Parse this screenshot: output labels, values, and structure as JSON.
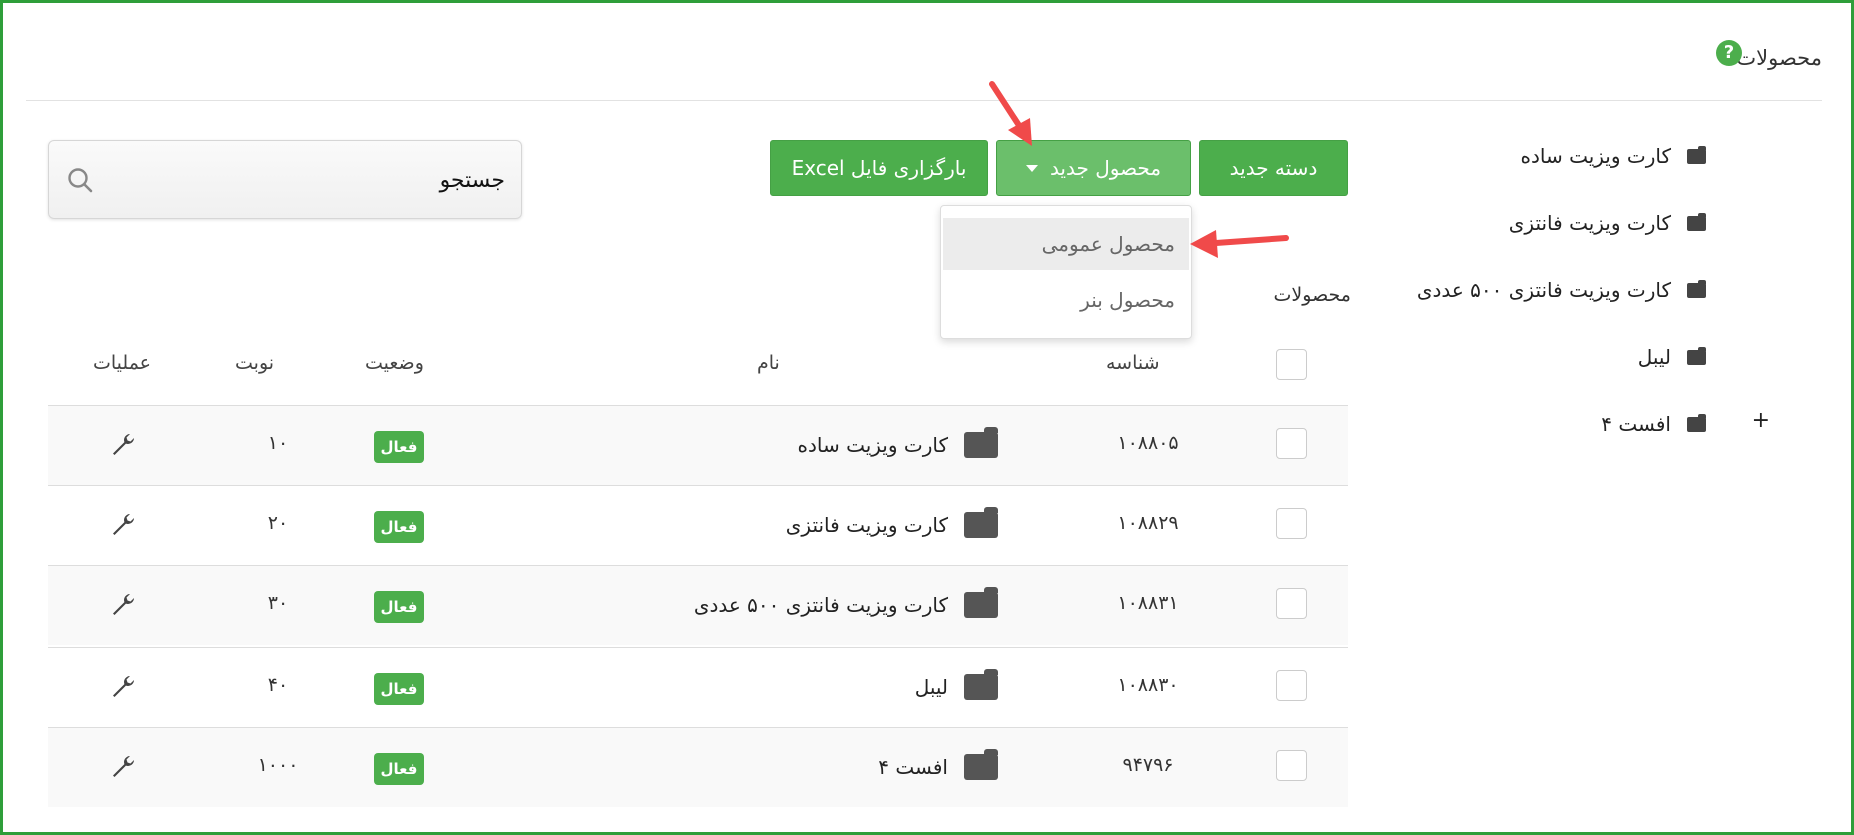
{
  "page": {
    "title": "محصولات",
    "help_icon": "question-circle-icon"
  },
  "sidebar": {
    "items": [
      {
        "label": "کارت ویزیت ساده",
        "icon": "folder-icon"
      },
      {
        "label": "کارت ویزیت فانتزی",
        "icon": "folder-icon"
      },
      {
        "label": "کارت ویزیت فانتزی ۵۰۰ عددی",
        "icon": "folder-icon"
      },
      {
        "label": "لیبل",
        "icon": "folder-icon"
      },
      {
        "label": "افست ۴",
        "icon": "folder-icon"
      }
    ],
    "expand_symbol": "+"
  },
  "toolbar": {
    "new_category": "دسته جدید",
    "new_product": "محصول جدید",
    "upload_excel": "بارگزاری فایل Excel"
  },
  "dropdown": {
    "items": [
      "محصول عمومی",
      "محصول بنر"
    ],
    "highlighted_index": 0
  },
  "search": {
    "placeholder": "جستجو",
    "icon": "search-icon"
  },
  "section_label": "محصولات",
  "table": {
    "headers": {
      "id": "شناسه",
      "name": "نام",
      "status": "وضعیت",
      "order": "نوبت",
      "actions": "عملیات"
    },
    "rows": [
      {
        "id": "۱۰۸۸۰۵",
        "name": "کارت ویزیت ساده",
        "status": "فعال",
        "order": "۱۰"
      },
      {
        "id": "۱۰۸۸۲۹",
        "name": "کارت ویزیت فانتزی",
        "status": "فعال",
        "order": "۲۰"
      },
      {
        "id": "۱۰۸۸۳۱",
        "name": "کارت ویزیت فانتزی ۵۰۰ عددی",
        "status": "فعال",
        "order": "۳۰"
      },
      {
        "id": "۱۰۸۸۳۰",
        "name": "لیبل",
        "status": "فعال",
        "order": "۴۰"
      },
      {
        "id": "۹۴۷۹۶",
        "name": "افست ۴",
        "status": "فعال",
        "order": "۱۰۰۰"
      }
    ]
  },
  "colors": {
    "accent": "#4cae4c",
    "frame": "#2e9e3a",
    "annotation_arrow": "#f04a4a"
  }
}
